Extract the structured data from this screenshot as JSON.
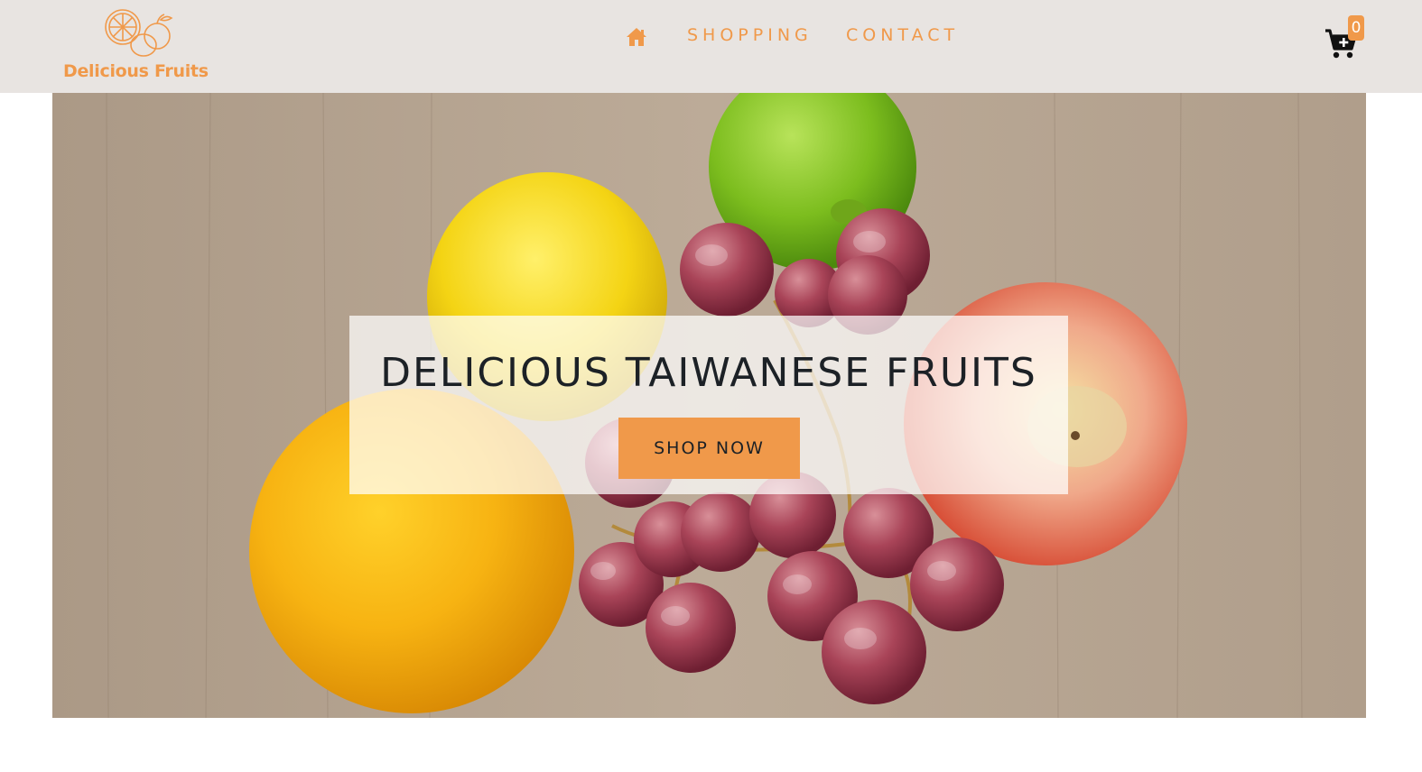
{
  "brand": {
    "name": "Delicious Fruits",
    "logo_icon": "fruit-outline-logo",
    "color": "#f0994a"
  },
  "nav": {
    "home_icon": "home-icon",
    "links": [
      "SHOPPING",
      "CONTACT"
    ]
  },
  "cart": {
    "icon": "cart-plus-icon",
    "count": "0"
  },
  "hero": {
    "title": "DELICIOUS TAIWANESE FRUITS",
    "button_label": "SHOP NOW",
    "image": "fruit-photo-background"
  },
  "colors": {
    "accent": "#f0994a",
    "navbar_bg": "#e8e4e1",
    "text_dark": "#1c2126"
  }
}
